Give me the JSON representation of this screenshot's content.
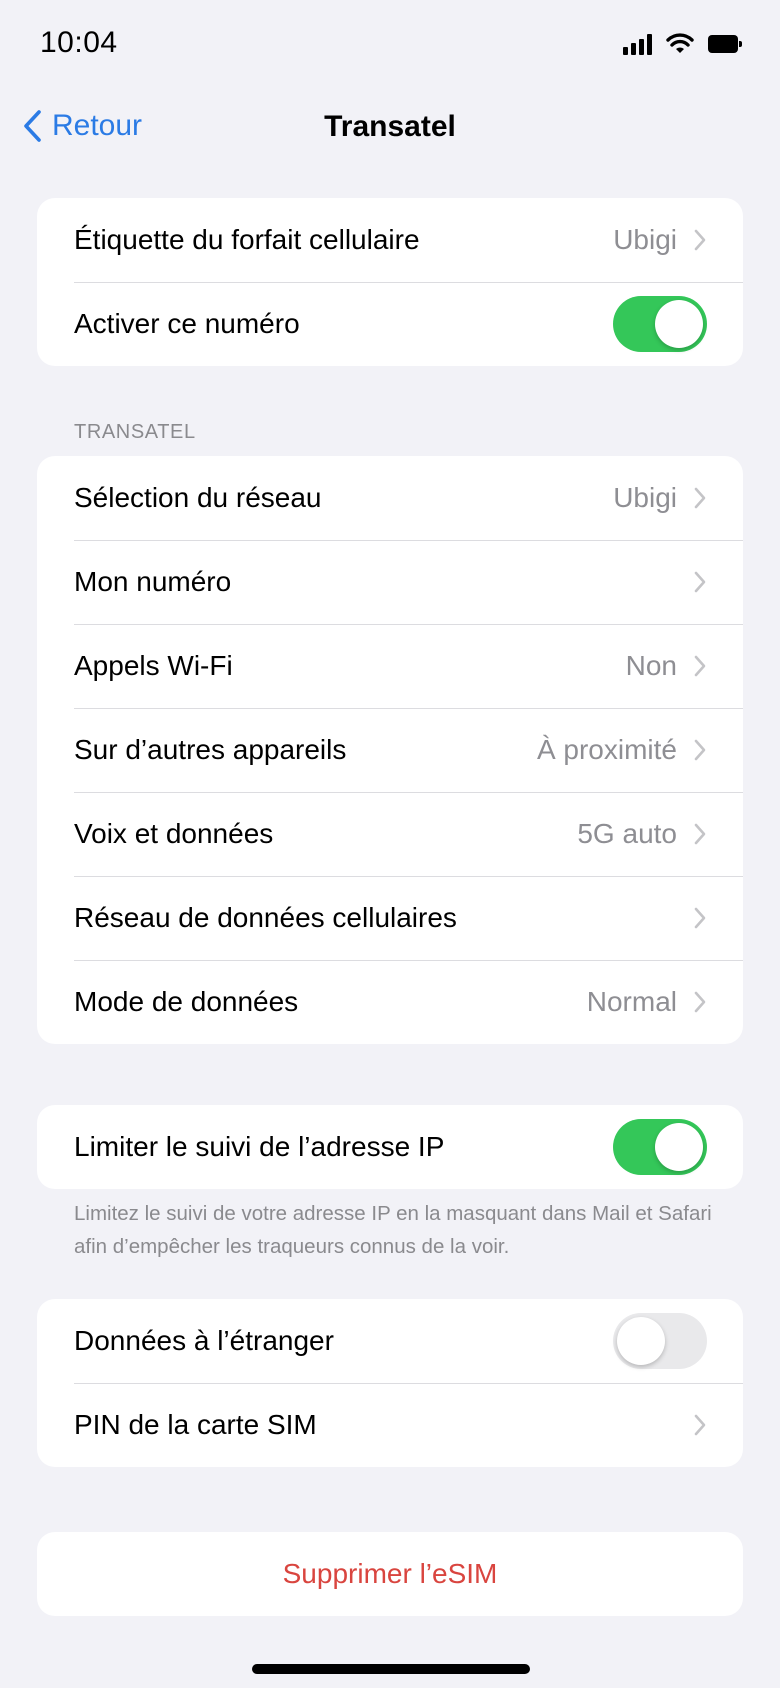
{
  "status_bar": {
    "time": "10:04",
    "icons": [
      "cellular-signal-icon",
      "wifi-icon",
      "battery-icon"
    ]
  },
  "nav": {
    "back_label": "Retour",
    "title": "Transatel"
  },
  "group_plan": {
    "rows": [
      {
        "label": "Étiquette du forfait cellulaire",
        "value": "Ubigi"
      },
      {
        "label": "Activer ce numéro",
        "toggle": true
      }
    ]
  },
  "section_transatel": {
    "header": "TRANSATEL",
    "rows": [
      {
        "label": "Sélection du réseau",
        "value": "Ubigi"
      },
      {
        "label": "Mon numéro",
        "value": ""
      },
      {
        "label": "Appels Wi-Fi",
        "value": "Non"
      },
      {
        "label": "Sur d’autres appareils",
        "value": "À proximité"
      },
      {
        "label": "Voix et données",
        "value": "5G auto"
      },
      {
        "label": "Réseau de données cellulaires",
        "value": ""
      },
      {
        "label": "Mode de données",
        "value": "Normal"
      }
    ]
  },
  "group_ip": {
    "rows": [
      {
        "label": "Limiter le suivi de l’adresse IP",
        "toggle": true
      }
    ],
    "footer": "Limitez le suivi de votre adresse IP en la masquant dans Mail et Safari afin d’empêcher les traqueurs connus de la voir."
  },
  "group_sim": {
    "rows": [
      {
        "label": "Données à l’étranger",
        "toggle": false
      },
      {
        "label": "PIN de la carte SIM",
        "value": ""
      }
    ]
  },
  "delete_esim": {
    "label": "Supprimer l’eSIM"
  },
  "colors": {
    "accent": "#2b7be5",
    "toggle_on": "#34c759",
    "destructive": "#d9453f",
    "background": "#f2f2f7"
  }
}
